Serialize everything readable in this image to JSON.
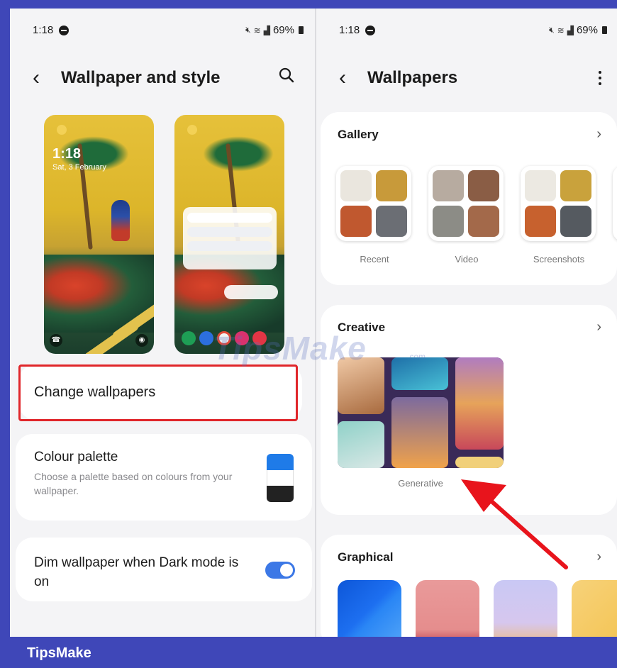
{
  "left": {
    "status": {
      "time": "1:18",
      "battery": "69%",
      "icons": [
        "mute-icon",
        "wifi-icon",
        "volte-icon",
        "signal-icon"
      ]
    },
    "header": {
      "title": "Wallpaper and style"
    },
    "lock_preview": {
      "time": "1:18",
      "date": "Sat, 3 February"
    },
    "change_wallpapers": {
      "label": "Change wallpapers"
    },
    "colour_palette": {
      "title": "Colour palette",
      "description": "Choose a palette based on colours from your wallpaper.",
      "swatch_colors": [
        "#1f7be8",
        "#ffffff",
        "#222222"
      ]
    },
    "dim_wallpaper": {
      "label": "Dim wallpaper when Dark mode is on",
      "enabled": true
    }
  },
  "right": {
    "status": {
      "time": "1:18",
      "battery": "69%"
    },
    "header": {
      "title": "Wallpapers"
    },
    "gallery": {
      "title": "Gallery",
      "albums": [
        {
          "label": "Recent"
        },
        {
          "label": "Video"
        },
        {
          "label": "Screenshots"
        }
      ]
    },
    "creative": {
      "title": "Creative",
      "item_label": "Generative"
    },
    "graphical": {
      "title": "Graphical"
    }
  },
  "watermark": {
    "text": "TipsMake",
    "suffix": ".com"
  },
  "footer": {
    "brand": "TipsMake"
  },
  "colors": {
    "highlight": "#e0262a",
    "accent": "#3c78e6",
    "footer": "#3f47b8",
    "arrow": "#e8141c"
  }
}
